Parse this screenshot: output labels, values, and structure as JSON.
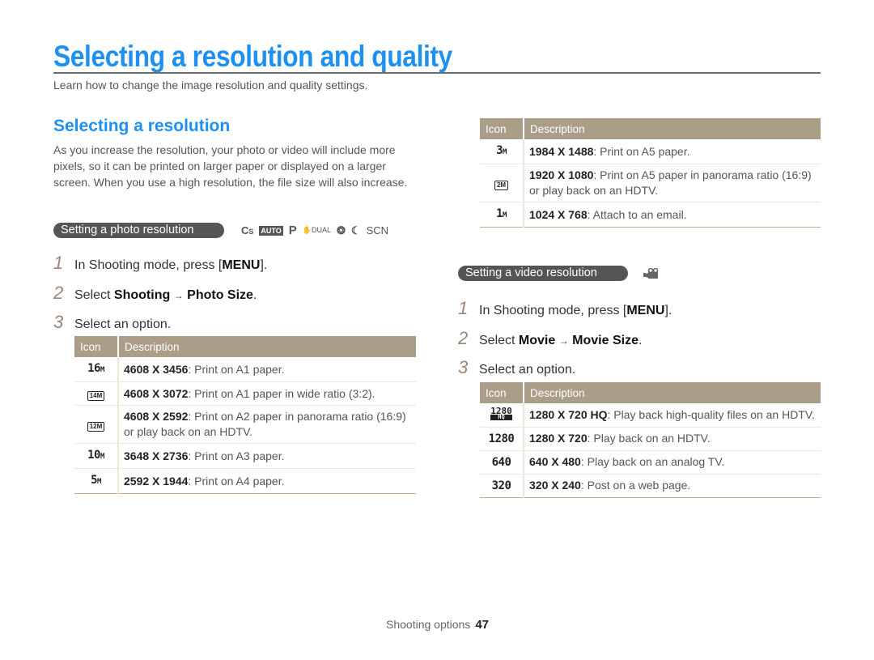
{
  "page": {
    "title": "Selecting a resolution and quality",
    "subtitle": "Learn how to change the image resolution and quality settings."
  },
  "section": {
    "title": "Selecting a resolution",
    "intro": "As you increase the resolution, your photo or video will include more pixels, so it can be printed on larger paper or displayed on a larger screen. When you use a high resolution, the file size will also increase."
  },
  "photo": {
    "pill": "Setting a photo resolution",
    "modes": [
      "smart-icon",
      "auto-icon",
      "program-icon",
      "dual-is-icon",
      "beauty-shot-icon",
      "night-icon",
      "scene-icon"
    ],
    "mode_labels": {
      "smart": "S",
      "auto": "AUTO",
      "program": "P",
      "dual": "DUAL",
      "scene": "SCN"
    },
    "steps": [
      {
        "num": "1",
        "pre": "In Shooting mode, press [",
        "bold": "MENU",
        "post": "]."
      },
      {
        "num": "2",
        "pre": "Select ",
        "bold": "Shooting",
        "arrow": "→",
        "bold2": "Photo Size",
        "post": "."
      },
      {
        "num": "3",
        "pre": "Select an option."
      }
    ]
  },
  "video": {
    "pill": "Setting a video resolution",
    "mode_icon": "movie-camera-icon",
    "steps": [
      {
        "num": "1",
        "pre": "In Shooting mode, press [",
        "bold": "MENU",
        "post": "]."
      },
      {
        "num": "2",
        "pre": "Select ",
        "bold": "Movie",
        "arrow": "→",
        "bold2": "Movie Size",
        "post": "."
      },
      {
        "num": "3",
        "pre": "Select an option."
      }
    ]
  },
  "table_headers": {
    "icon": "Icon",
    "description": "Description"
  },
  "photo_table_1": [
    {
      "icon": "16M",
      "icon_name": "16m-resolution-icon",
      "res": "4608 X 3456",
      "desc": ": Print on A1 paper."
    },
    {
      "icon": "14M",
      "icon_name": "14m-wide-resolution-icon",
      "res": "4608 X 3072",
      "desc": ": Print on A1 paper in wide ratio (3:2)."
    },
    {
      "icon": "12M",
      "icon_name": "12m-panorama-resolution-icon",
      "res": "4608 X 2592",
      "desc": ": Print on A2 paper in panorama ratio (16:9) or play back on an HDTV."
    },
    {
      "icon": "10M",
      "icon_name": "10m-resolution-icon",
      "res": "3648 X 2736",
      "desc": ": Print on A3 paper."
    },
    {
      "icon": "5M",
      "icon_name": "5m-resolution-icon",
      "res": "2592 X 1944",
      "desc": ": Print on A4 paper."
    }
  ],
  "photo_table_2": [
    {
      "icon": "3M",
      "icon_name": "3m-resolution-icon",
      "res": "1984 X 1488",
      "desc": ": Print on A5 paper."
    },
    {
      "icon": "2M",
      "icon_name": "2m-panorama-resolution-icon",
      "res": "1920 X 1080",
      "desc": ": Print on A5 paper in panorama ratio (16:9) or play back on an HDTV."
    },
    {
      "icon": "1M",
      "icon_name": "1m-resolution-icon",
      "res": "1024 X 768",
      "desc": ": Attach to an email."
    }
  ],
  "video_table": [
    {
      "icon": "1280",
      "icon_sub": "HQ",
      "icon_name": "1280-hq-resolution-icon",
      "res": "1280 X 720 HQ",
      "desc": ": Play back high-quality files on an HDTV."
    },
    {
      "icon": "1280",
      "icon_name": "1280-resolution-icon",
      "res": "1280 X 720",
      "desc": ": Play back on an HDTV."
    },
    {
      "icon": "640",
      "icon_name": "640-resolution-icon",
      "res": "640 X 480",
      "desc": ": Play back on an analog TV."
    },
    {
      "icon": "320",
      "icon_name": "320-resolution-icon",
      "res": "320 X 240",
      "desc": ": Post on a web page."
    }
  ],
  "footer": {
    "section": "Shooting options",
    "page_number": "47"
  },
  "colors": {
    "accent_blue": "#1e90f0",
    "table_header": "#ab9e88",
    "pill": "#555555",
    "step_number": "#9a8577"
  }
}
